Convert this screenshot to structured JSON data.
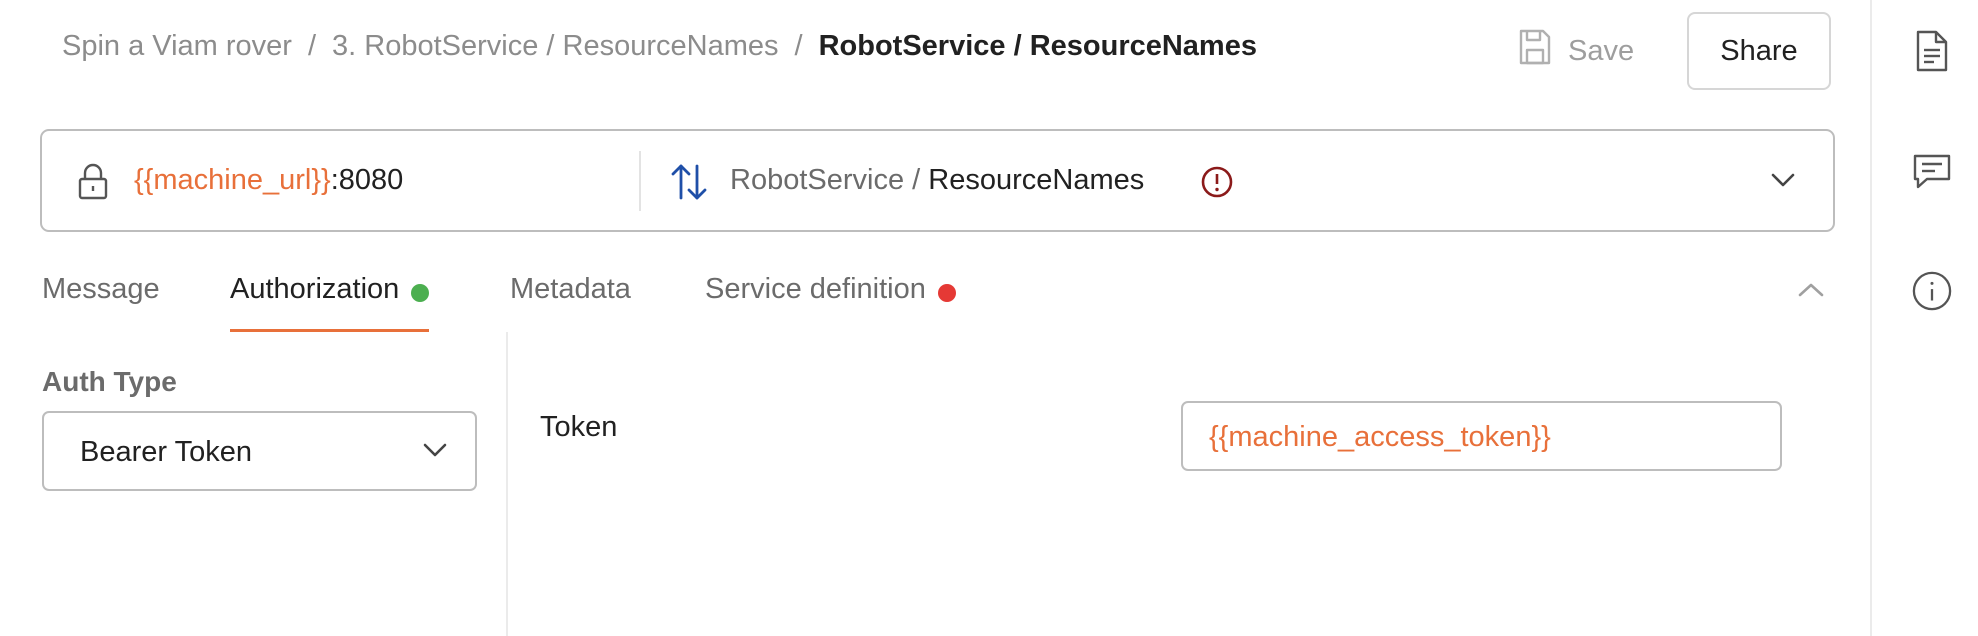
{
  "breadcrumb": {
    "items": [
      "Spin a Viam rover",
      "3. RobotService / ResourceNames"
    ],
    "separator": "/",
    "current": "RobotService / ResourceNames"
  },
  "actions": {
    "save_label": "Save",
    "share_label": "Share"
  },
  "right_rail": {
    "icons": [
      "document-icon",
      "comment-icon",
      "info-icon"
    ]
  },
  "url_bar": {
    "url_variable": "{{machine_url}}",
    "url_port": ":8080",
    "method_service": "RobotService / ",
    "method_name": "ResourceNames",
    "warning": true
  },
  "tabs": [
    {
      "label": "Message",
      "active": false,
      "status": null
    },
    {
      "label": "Authorization",
      "active": true,
      "status": "green"
    },
    {
      "label": "Metadata",
      "active": false,
      "status": null
    },
    {
      "label": "Service definition",
      "active": false,
      "status": "red"
    }
  ],
  "auth": {
    "type_label": "Auth Type",
    "type_value": "Bearer Token",
    "token_label": "Token",
    "token_value": "{{machine_access_token}}"
  },
  "colors": {
    "accent": "#e8703a",
    "status_green": "#4caf50",
    "status_red": "#e53935",
    "warning": "#8b1a1a",
    "method_icon": "#1f4fa8"
  }
}
